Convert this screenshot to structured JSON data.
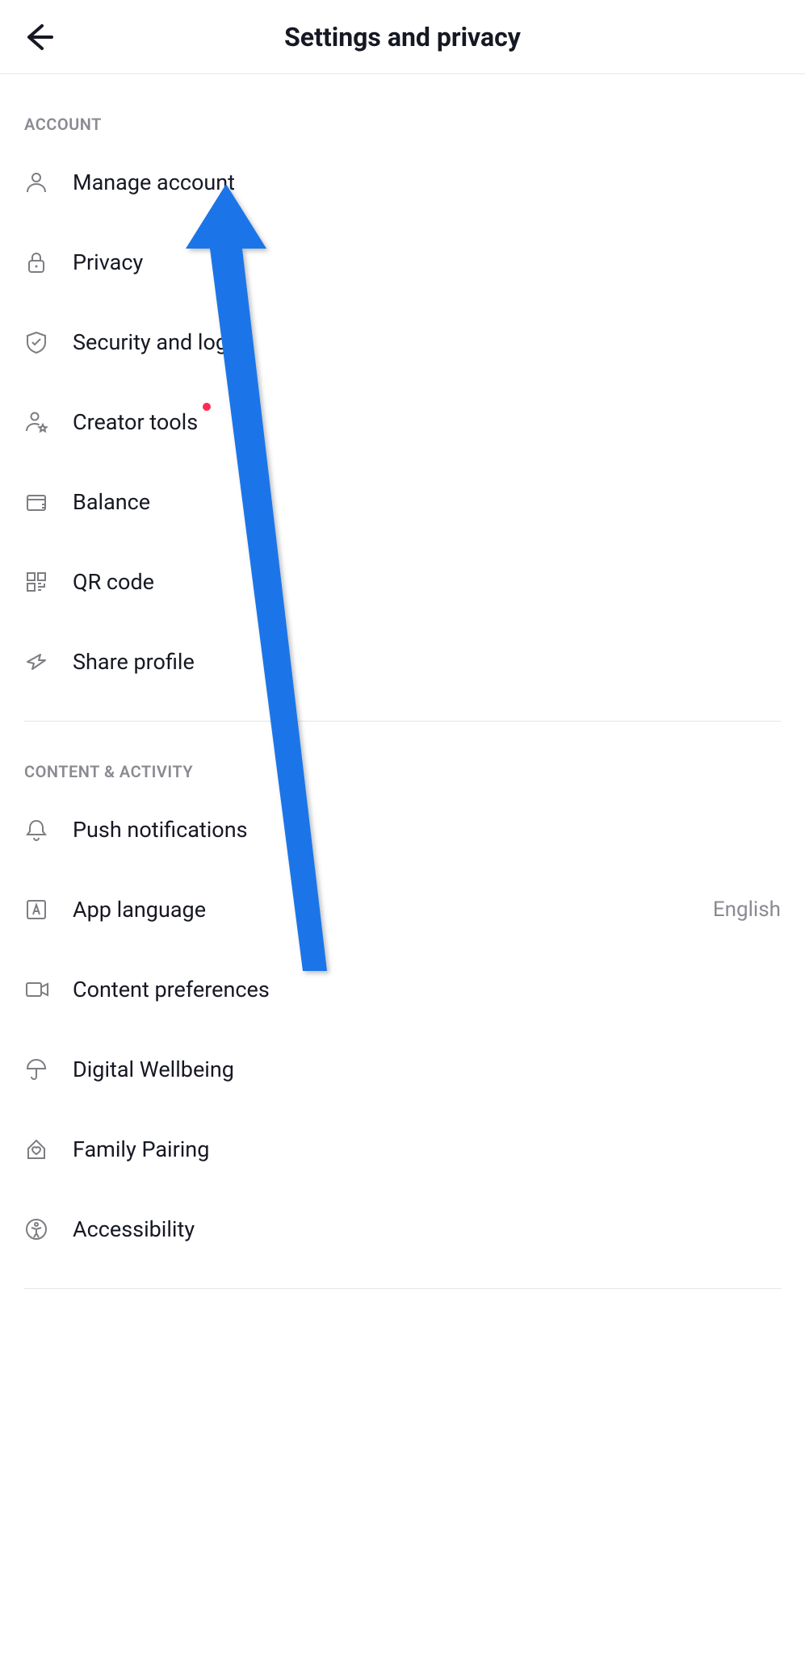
{
  "header": {
    "title": "Settings and privacy"
  },
  "sections": {
    "account": {
      "label": "Account",
      "items": {
        "manage_account": "Manage account",
        "privacy": "Privacy",
        "security": "Security and login",
        "creator_tools": "Creator tools",
        "balance": "Balance",
        "qr_code": "QR code",
        "share_profile": "Share profile"
      }
    },
    "content_activity": {
      "label": "Content & Activity",
      "items": {
        "push_notifications": "Push notifications",
        "app_language": {
          "label": "App language",
          "value": "English"
        },
        "content_preferences": "Content preferences",
        "digital_wellbeing": "Digital Wellbeing",
        "family_pairing": "Family Pairing",
        "accessibility": "Accessibility"
      }
    }
  },
  "annotation": {
    "arrow_color": "#1a74e8"
  }
}
